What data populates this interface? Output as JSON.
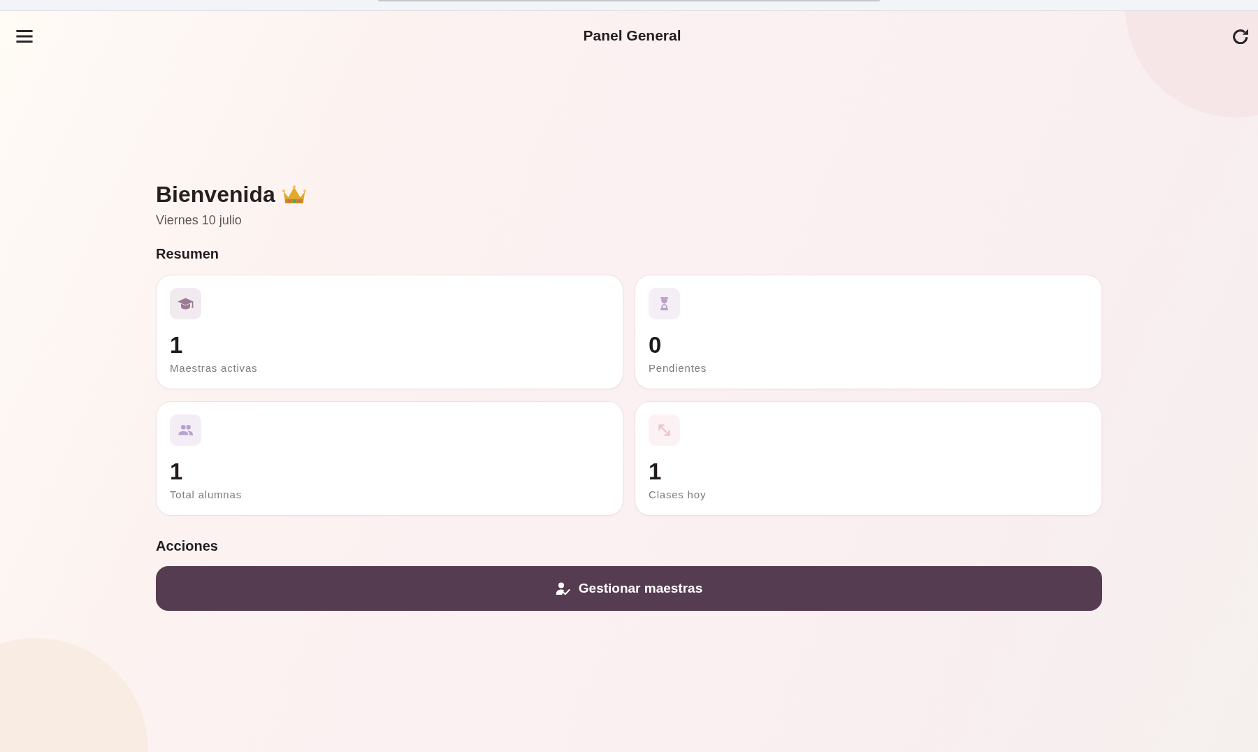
{
  "header": {
    "title": "Panel General"
  },
  "greeting": {
    "title": "Bienvenida",
    "date": "Viernes 10 julio"
  },
  "summary": {
    "heading": "Resumen",
    "stats": [
      {
        "kind": "graduation",
        "value": "1",
        "label": "Maestras activas"
      },
      {
        "kind": "hourglass",
        "value": "0",
        "label": "Pendientes"
      },
      {
        "kind": "people",
        "value": "1",
        "label": "Total alumnas"
      },
      {
        "kind": "arrows",
        "value": "1",
        "label": "Clases hoy"
      }
    ]
  },
  "actions": {
    "heading": "Acciones",
    "buttons": [
      {
        "label": "Gestionar maestras"
      }
    ]
  }
}
